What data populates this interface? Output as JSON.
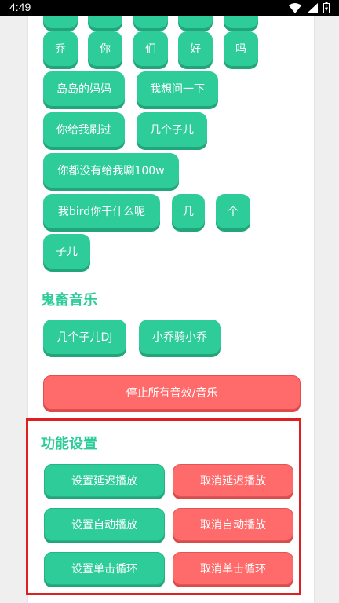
{
  "status_bar": {
    "time": "4:49"
  },
  "chips_row0": [
    "",
    "",
    "",
    "",
    ""
  ],
  "chips_row1": [
    "乔",
    "你",
    "们",
    "好",
    "吗"
  ],
  "chips_row2": [
    "岛岛的妈妈",
    "我想问一下"
  ],
  "chips_row3": [
    "你给我刷过",
    "几个子儿"
  ],
  "chips_row4": [
    "你都没有给我唰100w"
  ],
  "chips_row5": [
    "我bird你干什么呢",
    "几",
    "个"
  ],
  "chips_row6": [
    "子儿"
  ],
  "music_section": {
    "title": "鬼畜音乐",
    "items": [
      "几个子儿DJ",
      "小乔骑小乔"
    ]
  },
  "stop_button": {
    "label": "停止所有音效/音乐"
  },
  "settings_section": {
    "title": "功能设置",
    "set_delay": "设置延迟播放",
    "cancel_delay": "取消延迟播放",
    "set_auto": "设置自动播放",
    "cancel_auto": "取消自动播放",
    "set_loop": "设置单击循环",
    "cancel_loop": "取消单击循环"
  },
  "colors": {
    "green": "#2ecc99",
    "red": "#ff6b6b",
    "highlight": "#e02020"
  }
}
